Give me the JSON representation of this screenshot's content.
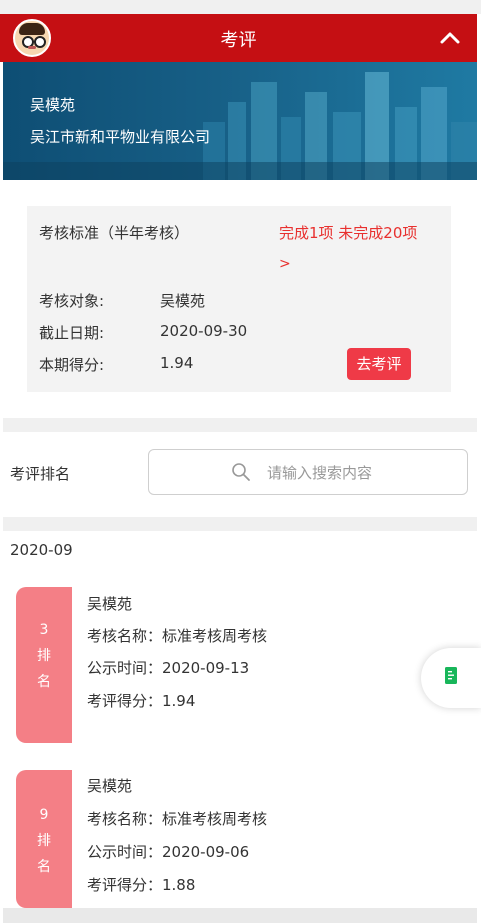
{
  "header": {
    "title": "考评",
    "avatar_icon": "avatar-icon",
    "collapse_icon": "chevron-up-icon",
    "color": "#c50f13"
  },
  "banner": {
    "name": "吴模苑",
    "company": "吴江市新和平物业有限公司"
  },
  "card": {
    "standard": "考核标准（半年考核）",
    "progress": "完成1项 未完成20项",
    "progress_arrow": ">",
    "target_label": "考核对象:",
    "target_value": "吴模苑",
    "deadline_label": "截止日期:",
    "deadline_value": "2020-09-30",
    "score_label": "本期得分:",
    "score_value": "1.94",
    "go_button": "去考评"
  },
  "ranking": {
    "label": "考评排名",
    "search_placeholder": "请输入搜索内容",
    "period": "2020-09",
    "entries": [
      {
        "rank": "3",
        "rank_char1": "排",
        "rank_char2": "名",
        "name": "吴模苑",
        "assessment": "考核名称：标准考核周考核",
        "published": "公示时间：2020-09-13",
        "score": "考评得分：1.94"
      },
      {
        "rank": "9",
        "rank_char1": "排",
        "rank_char2": "名",
        "name": "吴模苑",
        "assessment": "考核名称：标准考核周考核",
        "published": "公示时间：2020-09-06",
        "score": "考评得分：1.88"
      }
    ]
  },
  "floating": {
    "icon": "document-icon",
    "accent": "#18b65a"
  }
}
